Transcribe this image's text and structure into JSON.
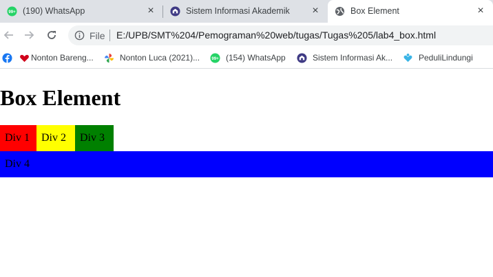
{
  "browser": {
    "tabs": [
      {
        "title": "(190) WhatsApp",
        "icon": "whatsapp-icon",
        "close": "×"
      },
      {
        "title": "Sistem Informasi Akademik",
        "icon": "university-icon",
        "close": "×"
      },
      {
        "title": "Box Element",
        "icon": "globe-icon",
        "close": "×",
        "active": true
      }
    ],
    "toolbar": {
      "back": "←",
      "forward": "→",
      "reload": "↻",
      "info": "i",
      "scheme_label": "File",
      "url": "E:/UPB/SMT%204/Pemograman%20web/tugas/Tugas%205/lab4_box.html"
    },
    "bookmarks": [
      {
        "label": "",
        "icon": "facebook-icon"
      },
      {
        "label": "Nonton Bareng...",
        "icon": "heart-icon"
      },
      {
        "label": "Nonton Luca (2021)...",
        "icon": "pinwheel-icon"
      },
      {
        "label": "(154) WhatsApp",
        "icon": "whatsapp-icon"
      },
      {
        "label": "Sistem Informasi Ak...",
        "icon": "university-icon"
      },
      {
        "label": "PeduliLindungi",
        "icon": "pedulilindungi-icon"
      }
    ]
  },
  "page": {
    "heading": "Box Element",
    "boxes": [
      {
        "label": "Div 1",
        "color": "#ff0000"
      },
      {
        "label": "Div 2",
        "color": "#ffff00"
      },
      {
        "label": "Div 3",
        "color": "#008000"
      },
      {
        "label": "Div 4",
        "color": "#0000ff"
      }
    ]
  },
  "colors": {
    "tabstrip": "#dee1e6",
    "omnibox": "#f1f3f4",
    "whatsapp_green": "#25d366",
    "facebook_blue": "#1877f2"
  }
}
